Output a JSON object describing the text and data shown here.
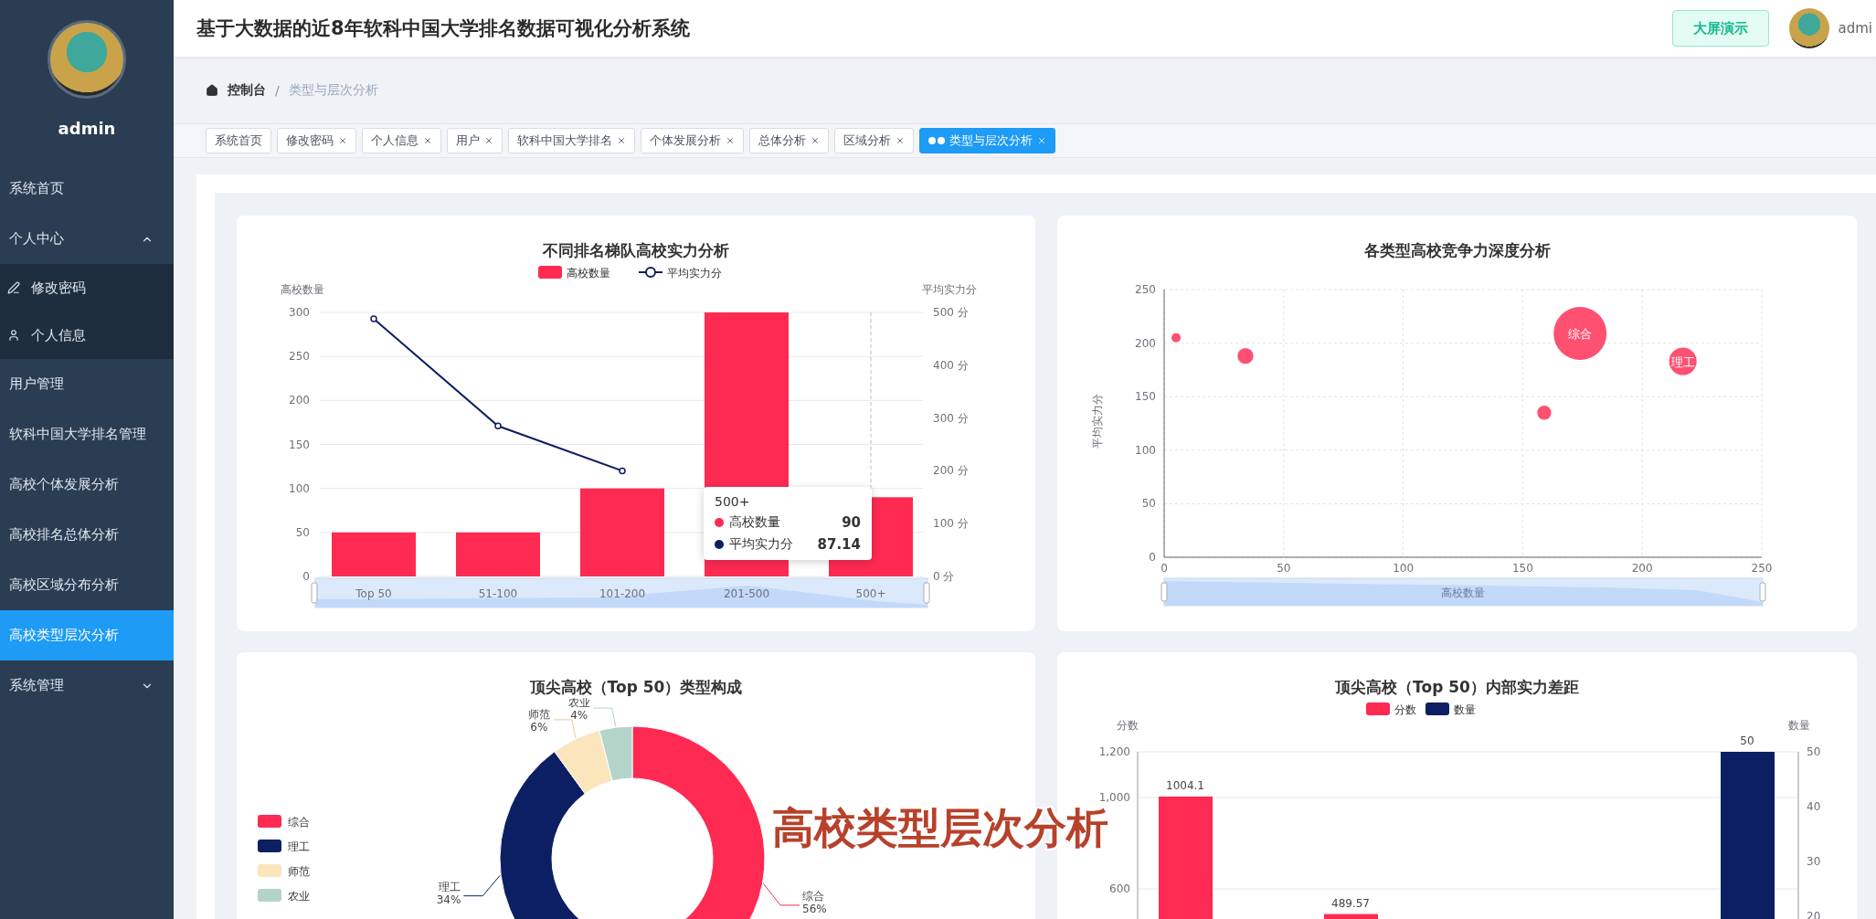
{
  "header": {
    "title": "基于大数据的近8年软科中国大学排名数据可视化分析系统",
    "big_screen_button": "大屏演示",
    "user": "admi"
  },
  "sidebar": {
    "user": "admin",
    "items": [
      {
        "label": "系统首页",
        "kind": "link",
        "selected": false
      },
      {
        "label": "个人中心",
        "kind": "group",
        "selected": false,
        "expanded": true,
        "children": [
          {
            "label": "修改密码",
            "selected": false
          },
          {
            "label": "个人信息",
            "selected": false
          }
        ]
      },
      {
        "label": "用户管理",
        "kind": "link",
        "selected": false
      },
      {
        "label": "软科中国大学排名管理",
        "kind": "link",
        "selected": false
      },
      {
        "label": "高校个体发展分析",
        "kind": "link",
        "selected": false
      },
      {
        "label": "高校排名总体分析",
        "kind": "link",
        "selected": false
      },
      {
        "label": "高校区域分布分析",
        "kind": "link",
        "selected": false
      },
      {
        "label": "高校类型层次分析",
        "kind": "link",
        "selected": true
      },
      {
        "label": "系统管理",
        "kind": "group",
        "selected": false,
        "expanded": false
      }
    ]
  },
  "breadcrumb": [
    "控制台",
    "类型与层次分析"
  ],
  "breadcrumb_separator": "/",
  "tabs": [
    {
      "label": "系统首页",
      "selected": false,
      "closable": false
    },
    {
      "label": "修改密码",
      "selected": false,
      "closable": true
    },
    {
      "label": "个人信息",
      "selected": false,
      "closable": true
    },
    {
      "label": "用户",
      "selected": false,
      "closable": true
    },
    {
      "label": "软科中国大学排名",
      "selected": false,
      "closable": true
    },
    {
      "label": "个体发展分析",
      "selected": false,
      "closable": true
    },
    {
      "label": "总体分析",
      "selected": false,
      "closable": true
    },
    {
      "label": "区域分析",
      "selected": false,
      "closable": true
    },
    {
      "label": "类型与层次分析",
      "selected": true,
      "closable": true
    }
  ],
  "cards": [
    {
      "chart_data": {
        "type": "bar",
        "title": "不同排名梯队高校实力分析",
        "legend": "top",
        "grid": true,
        "stacked": false,
        "ref_lines": [
          {
            "axis": "x",
            "value": "500+"
          }
        ],
        "categories": [
          "Top 50",
          "51-100",
          "101-200",
          "201-500",
          "500+"
        ],
        "ylabel": "高校数量",
        "y2label": "平均实力分",
        "ylim": [
          0,
          300
        ],
        "y2lim": [
          0,
          500
        ],
        "yticks": [
          0,
          50,
          100,
          150,
          200,
          250,
          300
        ],
        "y2ticks": [
          {
            "value": 0,
            "label": "0 分"
          },
          {
            "value": 100,
            "label": "100 分"
          },
          {
            "value": 200,
            "label": "200 分"
          },
          {
            "value": 300,
            "label": "300 分"
          },
          {
            "value": 400,
            "label": "400 分"
          },
          {
            "value": 500,
            "label": "500 分"
          }
        ],
        "series": [
          {
            "name": "高校数量",
            "type": "bar",
            "color": "#fe2a52",
            "values": [
              50,
              50,
              100,
              300,
              90
            ]
          },
          {
            "name": "平均实力分",
            "type": "line",
            "axis": "y2",
            "marker": "circle",
            "color": "#0c1f63",
            "values": [
              488,
              285,
              200,
              null,
              null
            ]
          }
        ]
      },
      "tooltip": {
        "title": "500+",
        "rows": [
          {
            "name": "高校数量",
            "value": "90",
            "color": "#fe2a52"
          },
          {
            "name": "平均实力分",
            "value": "87.14",
            "color": "#0c1f63"
          }
        ]
      }
    },
    {
      "chart_data": {
        "type": "scatter",
        "title": "各类型高校竞争力深度分析",
        "grid": true,
        "xlabel": "高校数量",
        "ylabel": "平均实力分",
        "xlim": [
          0,
          250
        ],
        "ylim": [
          0,
          250
        ],
        "xticks": [
          0,
          50,
          100,
          150,
          200,
          250
        ],
        "yticks": [
          0,
          50,
          100,
          150,
          200,
          250
        ],
        "x": [
          5,
          34,
          159,
          174,
          217
        ],
        "series": [
          {
            "color": "#fe3d62",
            "values": [
              205,
              188,
              135,
              209,
              183
            ],
            "sizes": [
              0.03,
              0.09,
              0.07,
              1,
              0.27
            ]
          }
        ],
        "annotations": [
          {
            "x": 174,
            "y": 209,
            "text": "综合"
          },
          {
            "x": 217,
            "y": 183,
            "text": "理工"
          }
        ]
      }
    },
    {
      "chart_data": {
        "type": "donut",
        "title": "顶尖高校（Top 50）类型构成",
        "legend": "left",
        "categories": [
          "综合",
          "理工",
          "师范",
          "农业"
        ],
        "values": [
          56,
          34,
          6,
          4
        ],
        "colors": [
          "#fe2a52",
          "#0c1f63",
          "#fbe5bd",
          "#b4d4c9"
        ],
        "value_labels": [
          "56%",
          "34%",
          "6%",
          "4%"
        ]
      }
    },
    {
      "chart_data": {
        "type": "bar",
        "title": "顶尖高校（Top 50）内部实力差距",
        "legend": "top",
        "grid": true,
        "stacked": false,
        "ylabel": "分数",
        "y2label": "数量",
        "ylim": [
          0,
          1200
        ],
        "y2lim": [
          0,
          50
        ],
        "yticks": [
          600,
          {
            "value": 1000,
            "label": "1,000"
          },
          {
            "value": 1200,
            "label": "1,200"
          }
        ],
        "y2ticks": [
          20,
          30,
          40,
          50
        ],
        "data_labels": true,
        "series": [
          {
            "name": "分数",
            "color": "#fe2a52",
            "values": [
              1004.1,
              489.57,
              null,
              null
            ]
          },
          {
            "name": "数量",
            "axis": "y2",
            "color": "#0c1f63",
            "values": [
              null,
              null,
              null,
              50
            ]
          }
        ]
      }
    }
  ],
  "overlay_caption": "高校类型层次分析"
}
